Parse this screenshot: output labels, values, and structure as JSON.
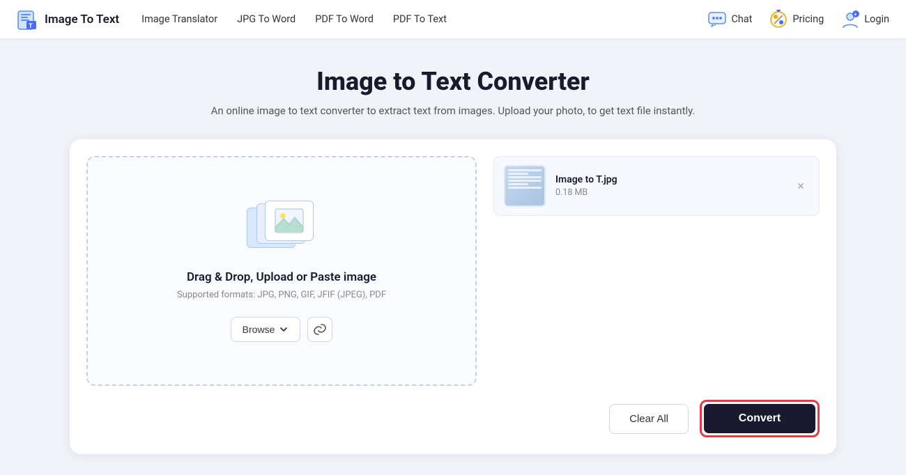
{
  "nav": {
    "logo_text": "Image To Text",
    "links": [
      {
        "label": "Image Translator",
        "id": "image-translator"
      },
      {
        "label": "JPG To Word",
        "id": "jpg-to-word"
      },
      {
        "label": "PDF To Word",
        "id": "pdf-to-word"
      },
      {
        "label": "PDF To Text",
        "id": "pdf-to-text"
      }
    ],
    "chat_label": "Chat",
    "pricing_label": "Pricing",
    "login_label": "Login"
  },
  "page": {
    "title": "Image to Text Converter",
    "subtitle": "An online image to text converter to extract text from images. Upload your photo, to get text file instantly."
  },
  "dropzone": {
    "title": "Drag & Drop, Upload or Paste image",
    "subtitle": "Supported formats: JPG, PNG, GIF, JFIF (JPEG), PDF",
    "browse_label": "Browse",
    "link_icon": "🔗"
  },
  "file": {
    "name": "Image to T.jpg",
    "size": "0.18 MB"
  },
  "footer": {
    "clear_label": "Clear All",
    "convert_label": "Convert"
  }
}
